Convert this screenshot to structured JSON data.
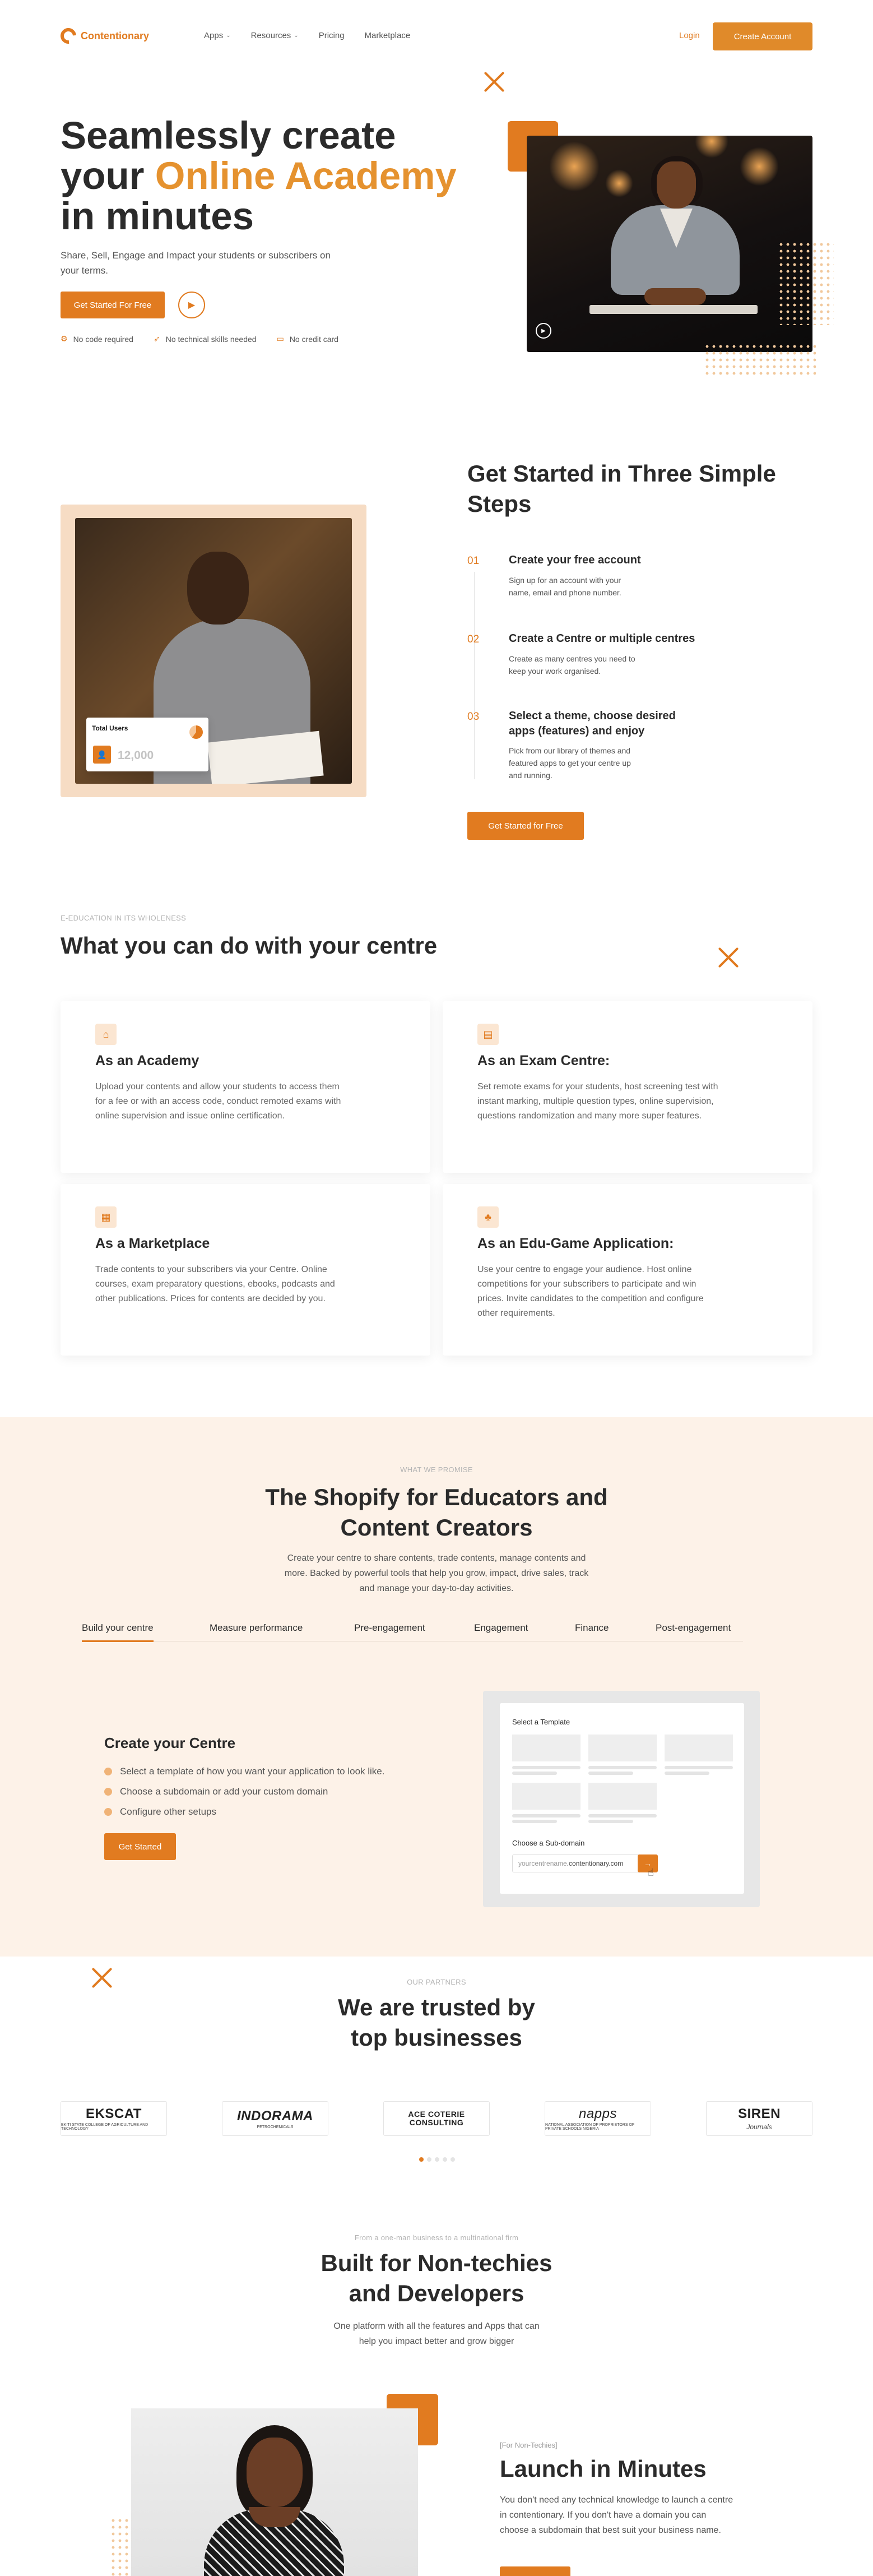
{
  "nav": {
    "logo": "Contentionary",
    "links": [
      {
        "label": "Apps",
        "has_dropdown": true
      },
      {
        "label": "Resources",
        "has_dropdown": true
      },
      {
        "label": "Pricing",
        "has_dropdown": false
      },
      {
        "label": "Marketplace",
        "has_dropdown": false
      }
    ],
    "login": "Login",
    "create_account": "Create Account"
  },
  "hero": {
    "title_line1": "Seamlessly create",
    "title_line2_prefix": "your ",
    "title_line2_accent": "Online Academy",
    "title_line3": "in minutes",
    "subtitle": "Share, Sell, Engage and Impact your students or subscribers on your terms.",
    "cta": "Get Started For Free",
    "features": [
      {
        "icon": "gear-icon",
        "label": "No code required"
      },
      {
        "icon": "rocket-icon",
        "label": "No technical skills needed"
      },
      {
        "icon": "card-icon",
        "label": "No credit card"
      }
    ]
  },
  "steps": {
    "title": "Get Started in Three Simple Steps",
    "stat_label": "Total Users",
    "stat_value": "12,000",
    "items": [
      {
        "num": "01",
        "title": "Create your free account",
        "desc": "Sign up for an account with your name, email and phone number."
      },
      {
        "num": "02",
        "title": "Create a Centre or multiple centres",
        "desc": "Create as many centres you need to keep your work organised."
      },
      {
        "num": "03",
        "title": "Select a theme, choose desired apps (features) and enjoy",
        "desc": "Pick from our library of themes and featured apps to get your centre up and running."
      }
    ],
    "cta": "Get Started for Free"
  },
  "centre": {
    "eyebrow": "E-EDUCATION IN ITS WHOLENESS",
    "title": "What you can do with your centre",
    "cards": [
      {
        "icon": "academy-icon",
        "title": "As an Academy",
        "text": "Upload your contents and allow your students to access them for a fee or with an access code, conduct remoted exams with online supervision and issue online certification."
      },
      {
        "icon": "book-icon",
        "title": "As an Exam Centre:",
        "text": "Set remote exams for your students, host screening test with instant marking, multiple question types, online supervision, questions randomization and many more super features."
      },
      {
        "icon": "store-icon",
        "title": "As a Marketplace",
        "text": "Trade contents to your subscribers via your Centre. Online courses, exam preparatory questions, ebooks, podcasts and other publications. Prices for contents are decided by you."
      },
      {
        "icon": "game-icon",
        "title": "As an Edu-Game Application:",
        "text": "Use your centre to engage your audience. Host online competitions for your subscribers to participate and win prices. Invite candidates to the competition and configure other requirements."
      }
    ]
  },
  "promise": {
    "eyebrow": "WHAT WE PROMISE",
    "title_line1": "The Shopify for Educators and",
    "title_line2": "Content Creators",
    "text": "Create your centre to share contents, trade contents, manage contents and more. Backed by powerful tools that help you grow, impact, drive sales, track and manage your day-to-day activities.",
    "tabs": [
      "Build your centre",
      "Measure performance",
      "Pre-engagement",
      "Engagement",
      "Finance",
      "Post-engagement"
    ],
    "active_tab": "Build your centre",
    "panel": {
      "title": "Create your Centre",
      "items": [
        "Select a template of how you want your application to look like.",
        "Choose a subdomain or add your custom domain",
        "Configure other setups"
      ],
      "cta": "Get Started",
      "mock_template_label": "Select a Template",
      "mock_subdomain_label": "Choose a Sub-domain",
      "mock_subdomain_prefix": "yourcentrename",
      "mock_subdomain_suffix": ".contentionary.com"
    }
  },
  "partners": {
    "eyebrow": "OUR PARTNERS",
    "title_line1": "We are trusted by",
    "title_line2": "top businesses",
    "logos": [
      {
        "name": "EKSCAT",
        "sub": "EKITI STATE COLLEGE OF AGRICULTURE AND TECHNOLOGY"
      },
      {
        "name": "INDORAMA",
        "sub": "PETROCHEMICALS"
      },
      {
        "name": "ACE COTERIE CONSULTING",
        "sub": ""
      },
      {
        "name": "napps",
        "sub": "NATIONAL ASSOCIATION OF PROPRIETORS OF PRIVATE SCHOOLS NIGERIA"
      },
      {
        "name": "SIREN",
        "sub": "Journals"
      }
    ],
    "pager_count": 5,
    "pager_active": 0
  },
  "builders": {
    "eyebrow": "From a one-man business to a multinational firm",
    "title_line1": "Built for Non-techies",
    "title_line2": "and Developers",
    "text": "One platform with all the features and Apps that can help you impact better and grow bigger",
    "launch_eyebrow": "[For Non-Techies]",
    "launch_title": "Launch in Minutes",
    "launch_text": "You don't need any technical knowledge to launch a centre in contentionary. If you don't have a domain you can choose a subdomain that best suit your business name."
  },
  "colors": {
    "accent": "#e17b20",
    "accent_light": "#e5922f",
    "peach_bg": "#fdf2e8",
    "text": "#2b2b2b"
  }
}
